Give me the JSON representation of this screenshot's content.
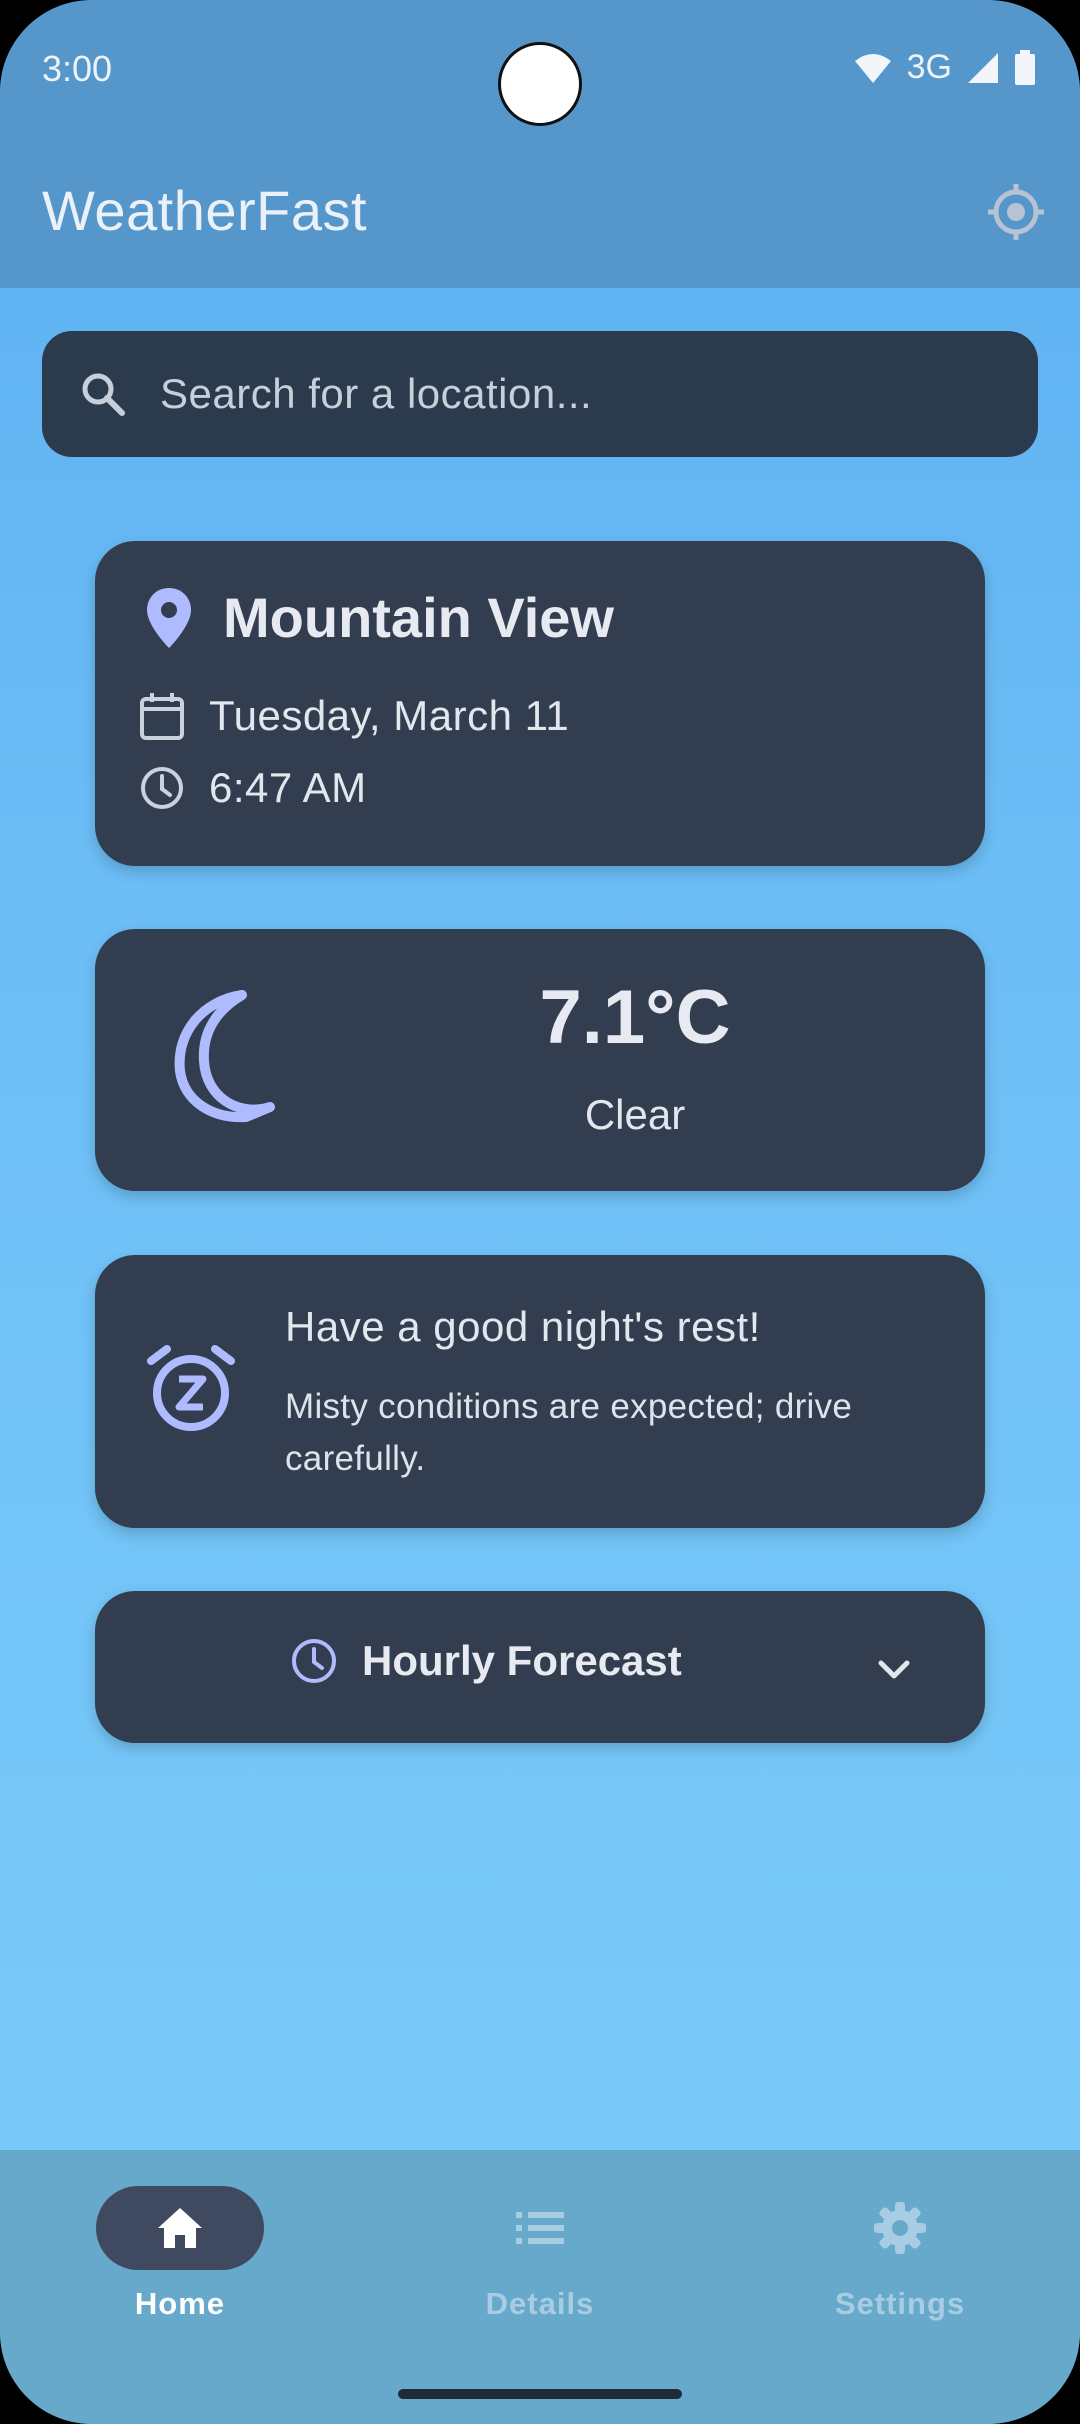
{
  "status": {
    "time": "3:00",
    "network": "3G"
  },
  "appbar": {
    "title": "WeatherFast"
  },
  "search": {
    "placeholder": "Search for a location..."
  },
  "location_card": {
    "city": "Mountain View",
    "date": "Tuesday, March 11",
    "time": "6:47 AM"
  },
  "weather_card": {
    "temperature": "7.1°C",
    "condition": "Clear",
    "icon": "moon-icon"
  },
  "message_card": {
    "title": "Have a good night's rest!",
    "body": "Misty conditions are expected; drive carefully.",
    "icon": "alarm-snooze-icon"
  },
  "hourly": {
    "label": "Hourly Forecast"
  },
  "nav": {
    "home": "Home",
    "details": "Details",
    "settings": "Settings",
    "active": "Home"
  },
  "colors": {
    "appbar": "#5596cb",
    "card": "#323e4f",
    "accent": "#aebcff",
    "nav_bg": "#66a9ca",
    "nav_active": "#3f4a60"
  }
}
